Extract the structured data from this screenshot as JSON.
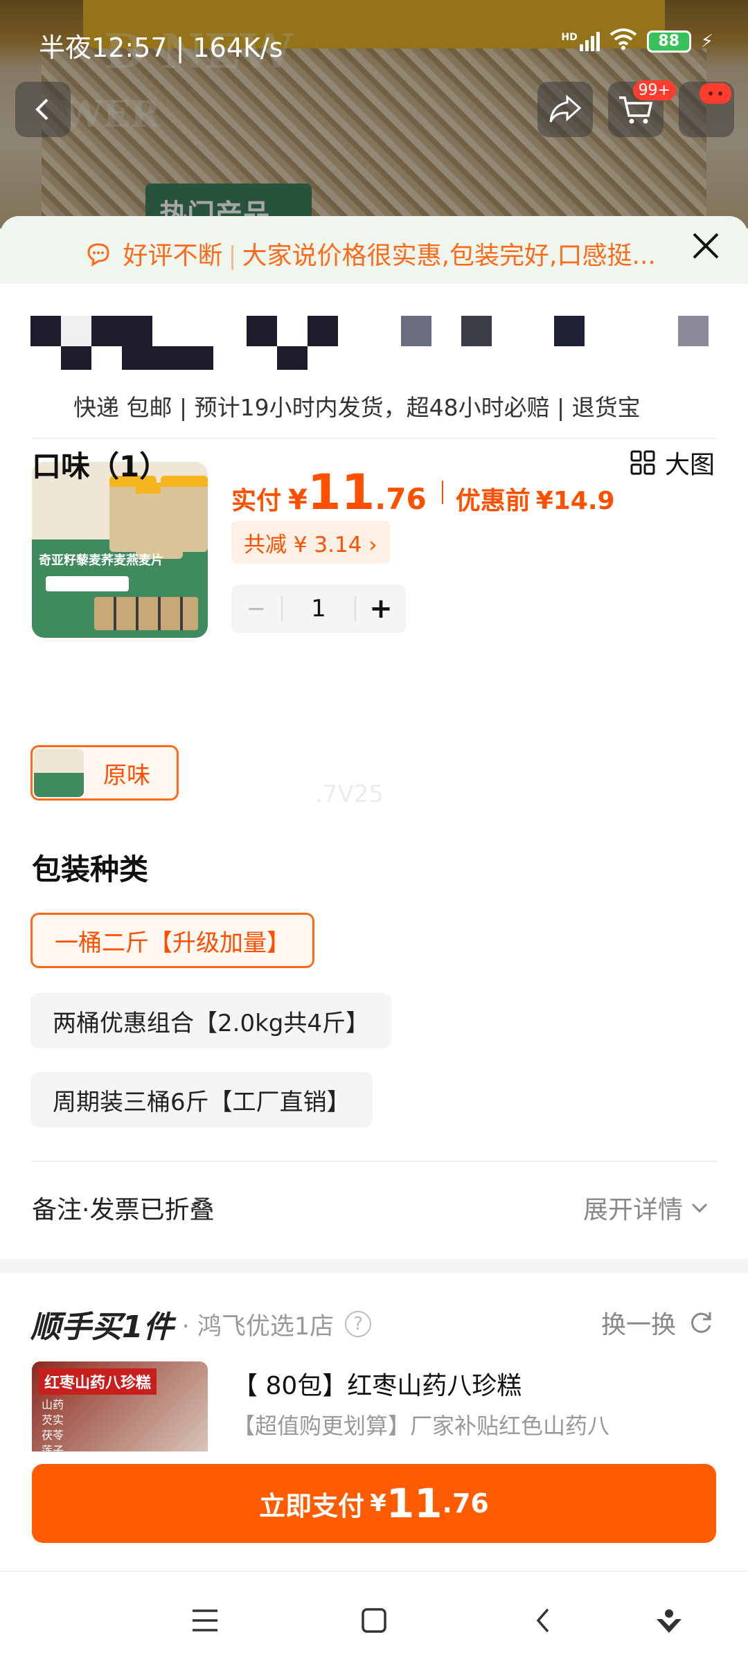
{
  "status_bar": {
    "time": "半夜12:57 | 164K/s",
    "network_label": "HD",
    "battery": "88"
  },
  "top_nav": {
    "cart_badge": "99+"
  },
  "background_image": {
    "overlay_text_1": "D NEW",
    "overlay_text_2": "WER",
    "label_text": "热门产品"
  },
  "review_banner": {
    "highlight": "好评不断",
    "text": "大家说价格很实惠,包装完好,口感挺..."
  },
  "service_line": "快递 包邮 | 预计19小时内发货，超48小时必赔 | 退货宝",
  "product": {
    "pay_label": "实付",
    "currency": "¥",
    "price_int": "11",
    "price_dec": ".76",
    "before_label": "优惠前",
    "before_price": "¥14.9",
    "discount_text": "共减 ¥ 3.14 ›",
    "quantity": "1",
    "minus": "−",
    "plus": "+",
    "thumb_caption": "奇亚籽藜麦荞麦燕麦片"
  },
  "flavor": {
    "title": "口味（1）",
    "big_picture_label": "大图",
    "options": [
      "原味"
    ]
  },
  "watermark": ".7V25",
  "package": {
    "title": "包装种类",
    "options": [
      "一桶二斤【升级加量】",
      "两桶优惠组合【2.0kg共4斤】",
      "周期装三桶6斤【工厂直销】"
    ],
    "selected_index": 0
  },
  "remark": {
    "label": "备注·发票已折叠",
    "expand": "展开详情"
  },
  "add_on": {
    "brand": "顺手买1件",
    "shop": "· 鸿飞优选1店",
    "help": "?",
    "swap": "换一换",
    "item": {
      "thumb_tag": "红枣山药八珍糕",
      "thumb_list": [
        "山药",
        "芡实",
        "茯苓",
        "莲子"
      ],
      "title": "【 80包】红枣山药八珍糕",
      "subtitle": "【超值购更划算】厂家补贴红色山药八"
    }
  },
  "pay_button": {
    "label": "立即支付",
    "currency": "¥",
    "int": "11",
    "dec": ".76"
  },
  "colors": {
    "accent": "#ff5b00",
    "banner_bg": "#eef6ee",
    "option_bg": "#f3f5f7"
  }
}
